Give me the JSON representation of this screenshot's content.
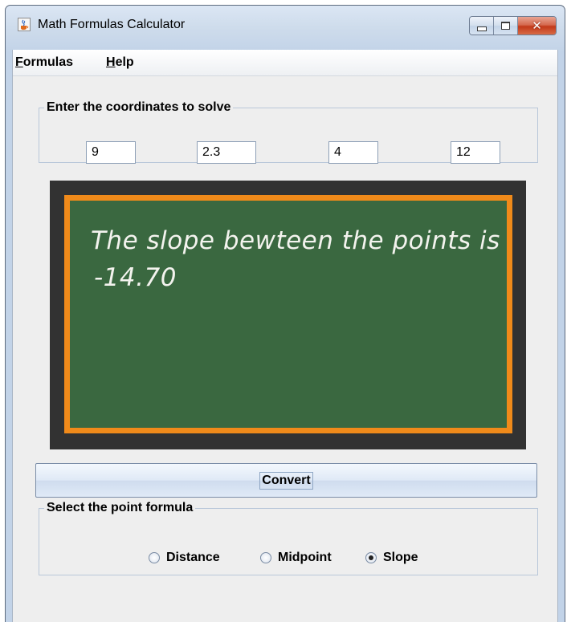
{
  "window": {
    "title": "Math Formulas Calculator",
    "close_glyph": "✕"
  },
  "menu": {
    "items": [
      {
        "mnemonic": "F",
        "rest": "ormulas"
      },
      {
        "mnemonic": "H",
        "rest": "elp"
      }
    ]
  },
  "coordinates": {
    "legend": "Enter the coordinates to solve",
    "values": [
      "9",
      "2.3",
      "4",
      "12"
    ]
  },
  "chalkboard": {
    "lines": [
      "The slope bewteen the points is",
      "-14.70"
    ]
  },
  "convert": {
    "label": "Convert"
  },
  "formula": {
    "legend": "Select the point formula",
    "options": [
      "Distance",
      "Midpoint",
      "Slope"
    ],
    "selected": "Slope"
  },
  "colors": {
    "chalkboard_green": "#3a6840",
    "frame_orange": "#f08a1a",
    "frame_dark": "#323232",
    "close_red": "#c2391a"
  },
  "icons": {
    "app": "java-cup-icon",
    "minimize": "minimize-icon",
    "maximize": "maximize-icon",
    "close": "close-icon",
    "radio": "radio-button-icon"
  }
}
